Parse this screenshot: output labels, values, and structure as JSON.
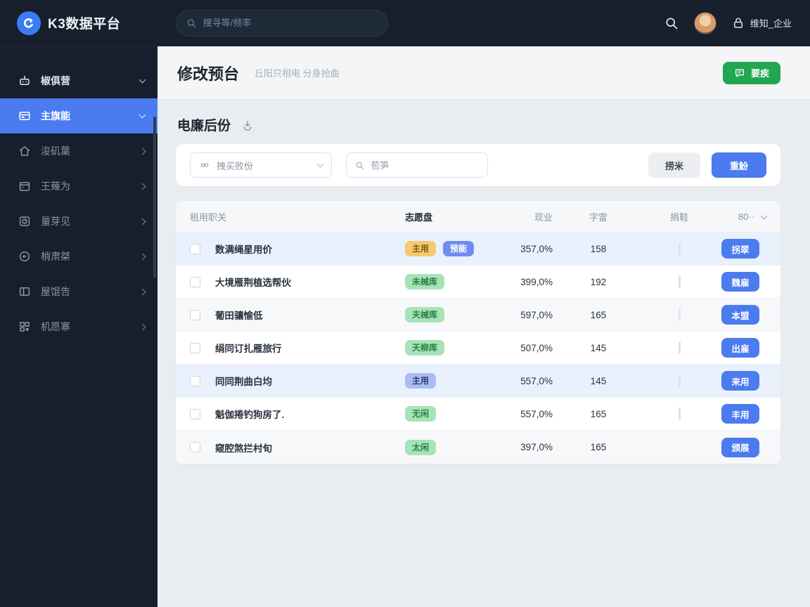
{
  "colors": {
    "sidebar_bg": "#161f2b",
    "accent_blue": "#4b7bef",
    "active_item_blue": "#4a7cf0",
    "green_button": "#21a74f",
    "badge_amber": "#f6c96d",
    "badge_green": "#a5e4b6",
    "badge_blue": "#6f8cf0",
    "badge_periwinkle": "#a9bdf0",
    "row_selected_bg": "#e9f1fd"
  },
  "topbar": {
    "logo_text": "K3数据平台",
    "search_placeholder": "搜寻等/频率",
    "icons": [
      "search-icon",
      "lock-icon"
    ],
    "user_name": "维知_企业"
  },
  "sidebar": {
    "items": [
      {
        "label": "椒俱营",
        "icon": "robot-icon",
        "chevron": "down",
        "active": false
      },
      {
        "label": "主旗能",
        "icon": "browser-icon",
        "chevron": "down",
        "active": true
      },
      {
        "label": "浚矶葉",
        "icon": "home-icon",
        "chevron": "right",
        "active": false
      },
      {
        "label": "王薙为",
        "icon": "calendar-icon",
        "chevron": "right",
        "active": false
      },
      {
        "label": "量芽见",
        "icon": "clock-icon",
        "chevron": "right",
        "active": false
      },
      {
        "label": "梢肃桀",
        "icon": "compass-icon",
        "chevron": "right",
        "active": false
      },
      {
        "label": "屋馄告",
        "icon": "layout-icon",
        "chevron": "right",
        "active": false
      },
      {
        "label": "机愿寨",
        "icon": "grid-icon",
        "chevron": "right",
        "active": false
      }
    ]
  },
  "page": {
    "title": "修改预台",
    "subtitle": "丘阳只相电 分身抢曲",
    "green_button_label": "要疾",
    "section_title": "电廉后份"
  },
  "filters": {
    "category_select_label": "拽买败份",
    "search_placeholder": "苞笋",
    "secondary_button": "捞米",
    "primary_button": "重魵"
  },
  "table": {
    "headers": {
      "name": "租用职关",
      "status": "志愿盘",
      "percent": "现业",
      "count": "字雷",
      "bar": "捐鞋",
      "more": "80··"
    },
    "rows": [
      {
        "name": "数满绳星用价",
        "badges": [
          {
            "text": "主用",
            "type": "amber"
          },
          {
            "text": "预能",
            "type": "blue"
          }
        ],
        "percent": "357,0%",
        "count": "158",
        "action": "拐翠",
        "selected": true
      },
      {
        "name": "大境雁荆植选帮伙",
        "badges": [
          {
            "text": "未械库",
            "type": "green"
          }
        ],
        "percent": "399,0%",
        "count": "192",
        "action": "魏雇",
        "selected": false
      },
      {
        "name": "葡田骧愉低",
        "badges": [
          {
            "text": "夫械库",
            "type": "green"
          }
        ],
        "percent": "597,0%",
        "count": "165",
        "action": "本盟",
        "selected": false
      },
      {
        "name": "绢同订扎雁旅行",
        "badges": [
          {
            "text": "天柳库",
            "type": "green"
          }
        ],
        "percent": "507,0%",
        "count": "145",
        "action": "出雇",
        "selected": false
      },
      {
        "name": "同同荆曲白均",
        "badges": [
          {
            "text": "主用",
            "type": "periwinkle"
          }
        ],
        "percent": "557,0%",
        "count": "145",
        "action": "来用",
        "selected": true
      },
      {
        "name": "魁伽捲钓狗房了.",
        "badges": [
          {
            "text": "无闲",
            "type": "green"
          }
        ],
        "percent": "557,0%",
        "count": "165",
        "action": "丰用",
        "selected": false
      },
      {
        "name": "窥腔煞拦村旬",
        "badges": [
          {
            "text": "太闲",
            "type": "green"
          }
        ],
        "percent": "397,0%",
        "count": "165",
        "action": "颁展",
        "selected": false
      }
    ]
  }
}
